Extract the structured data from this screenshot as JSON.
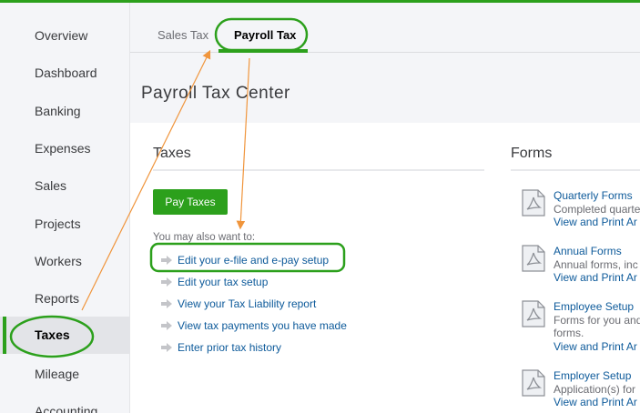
{
  "sidebar": {
    "items": [
      {
        "label": "Overview"
      },
      {
        "label": "Dashboard"
      },
      {
        "label": "Banking"
      },
      {
        "label": "Expenses"
      },
      {
        "label": "Sales"
      },
      {
        "label": "Projects"
      },
      {
        "label": "Workers"
      },
      {
        "label": "Reports"
      },
      {
        "label": "Taxes"
      },
      {
        "label": "Mileage"
      },
      {
        "label": "Accounting"
      }
    ],
    "active": "Taxes"
  },
  "tabs": [
    {
      "label": "Sales Tax"
    },
    {
      "label": "Payroll Tax"
    }
  ],
  "header": {
    "title": "Payroll Tax Center"
  },
  "taxes": {
    "title": "Taxes",
    "pay_button": "Pay Taxes",
    "also_label": "You may also want to:",
    "links": [
      {
        "label": "Edit your e-file and e-pay setup"
      },
      {
        "label": "Edit your tax setup"
      },
      {
        "label": "View your Tax Liability report"
      },
      {
        "label": "View tax payments you have made"
      },
      {
        "label": "Enter prior tax history"
      }
    ]
  },
  "forms": {
    "title": "Forms",
    "items": [
      {
        "title": "Quarterly Forms",
        "desc": "Completed quarte",
        "desc2": "",
        "link": "View and Print Ar"
      },
      {
        "title": "Annual Forms",
        "desc": "Annual forms, inc",
        "desc2": "",
        "link": "View and Print Ar"
      },
      {
        "title": "Employee Setup",
        "desc": "Forms for you and",
        "desc2": "forms.",
        "link": "View and Print Ar"
      },
      {
        "title": "Employer Setup",
        "desc": "Application(s) for",
        "desc2": "",
        "link": "View and Print Ar"
      }
    ]
  },
  "colors": {
    "brand_green": "#2ca01c",
    "link_blue": "#0d5a9a",
    "annotation_orange": "#f0953c"
  }
}
